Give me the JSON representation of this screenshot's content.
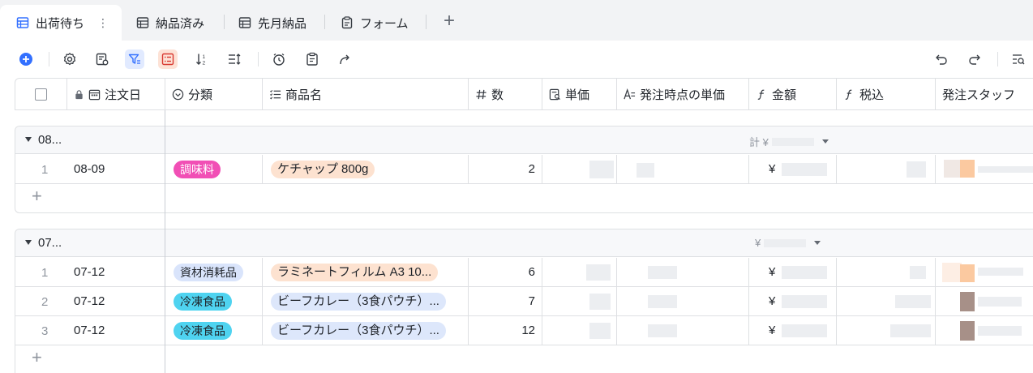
{
  "tabs": [
    {
      "label": "出荷待ち",
      "active": true
    },
    {
      "label": "納品済み",
      "active": false
    },
    {
      "label": "先月納品",
      "active": false
    },
    {
      "label": "フォーム",
      "active": false
    }
  ],
  "columns": {
    "date": "注文日",
    "category": "分類",
    "product": "商品名",
    "qty": "数",
    "unit_price": "単価",
    "order_unit_price": "発注時点の単価",
    "amount": "金額",
    "tax_incl": "税込",
    "staff": "発注スタッフ"
  },
  "groups": [
    {
      "title": "08...",
      "sum_prefix": "計 ¥",
      "rows": [
        {
          "no": "1",
          "date": "08-09",
          "category": "調味料",
          "product": "ケチャップ 800g",
          "qty": "2",
          "amount_prefix": "¥"
        }
      ]
    },
    {
      "title": "07...",
      "sum_prefix": "¥",
      "rows": [
        {
          "no": "1",
          "date": "07-12",
          "category": "資材消耗品",
          "product": "ラミネートフィルム A3 10...",
          "qty": "6",
          "amount_prefix": "¥"
        },
        {
          "no": "2",
          "date": "07-12",
          "category": "冷凍食品",
          "product": "ビーフカレー（3食パウチ）...",
          "qty": "7",
          "amount_prefix": "¥"
        },
        {
          "no": "3",
          "date": "07-12",
          "category": "冷凍食品",
          "product": "ビーフカレー（3食パウチ）...",
          "qty": "12",
          "amount_prefix": "¥"
        }
      ]
    }
  ],
  "colors": {
    "accent": "#3370ff",
    "tag_seasoning": "#f14fb5",
    "tag_supplies": "#d9e4fb",
    "tag_frozen": "#4fd3f0",
    "tag_product_orange": "#fde2d0",
    "tag_product_blue": "#dde7fb",
    "staff_orange": "#fbc9a0",
    "staff_brown": "#a79088"
  }
}
